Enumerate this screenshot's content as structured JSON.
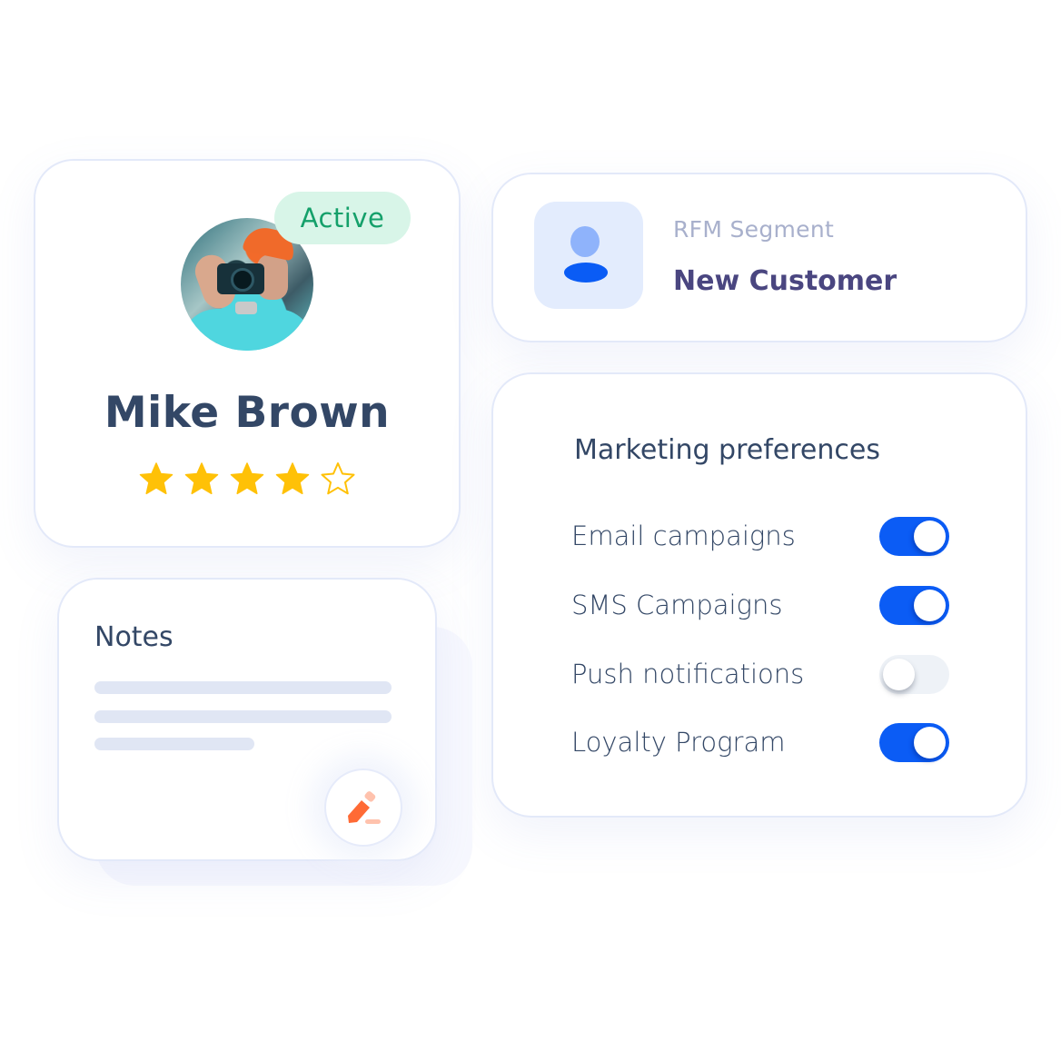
{
  "profile": {
    "status_badge": "Active",
    "name": "Mike Brown",
    "rating": {
      "value": 4,
      "max": 5
    },
    "avatar": "profile-photo-man-with-camera"
  },
  "rfm": {
    "label": "RFM Segment",
    "value": "New Customer",
    "icon": "user-icon"
  },
  "marketing_preferences": {
    "title": "Marketing preferences",
    "items": [
      {
        "label": "Email campaigns",
        "enabled": true
      },
      {
        "label": "SMS Campaigns",
        "enabled": true
      },
      {
        "label": "Push notifications",
        "enabled": false
      },
      {
        "label": "Loyalty Program",
        "enabled": true
      }
    ]
  },
  "notes": {
    "title": "Notes",
    "edit_icon": "pencil-icon"
  },
  "colors": {
    "accent_blue": "#0b5cf5",
    "active_green": "#14a06a",
    "active_bg": "#d8f5e8",
    "star_yellow": "#ffc107",
    "text_dark": "#334766",
    "segment_purple": "#4a4680",
    "pencil_orange": "#ff6a35"
  }
}
